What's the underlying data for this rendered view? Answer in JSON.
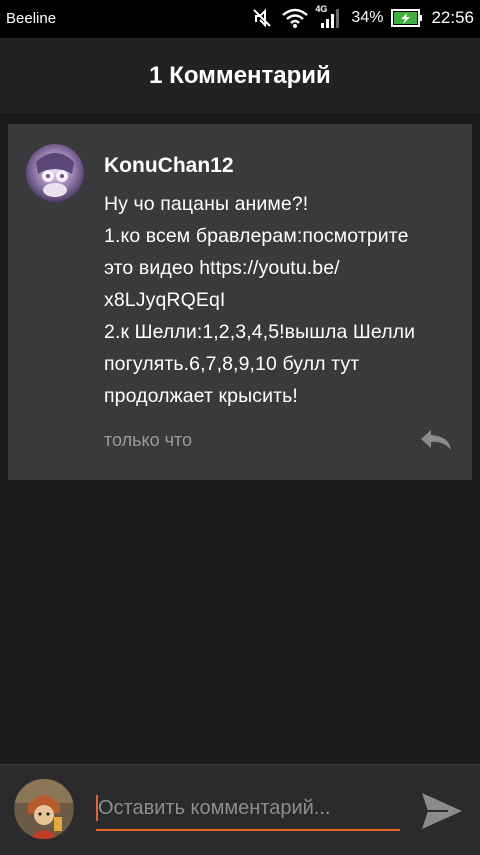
{
  "status_bar": {
    "carrier": "Beeline",
    "network_type": "4G",
    "battery_percent": "34%",
    "time": "22:56",
    "icons": [
      "mute-icon",
      "wifi-icon",
      "signal-icon",
      "battery-charging-icon"
    ]
  },
  "header": {
    "title": "1 Комментарий"
  },
  "comments": [
    {
      "username": "KonuChan12",
      "lines": [
        "Ну чо пацаны аниме?!",
        "1.ко всем бравлерам:посмотрите",
        "это видео https://youtu.be/",
        "x8LJyqRQEqI",
        "2.к Шелли:1,2,3,4,5!вышла Шелли",
        "погулять.6,7,8,9,10 булл тут",
        "продолжает крысить!"
      ],
      "time": "только что",
      "reply_icon": "reply-icon"
    }
  ],
  "composer": {
    "placeholder": "Оставить комментарий...",
    "send_icon": "send-icon"
  },
  "colors": {
    "background": "#1b1a1b",
    "header": "#232223",
    "card": "#3a393b",
    "accent": "#e8652a",
    "muted_text": "#9b9a9c"
  }
}
